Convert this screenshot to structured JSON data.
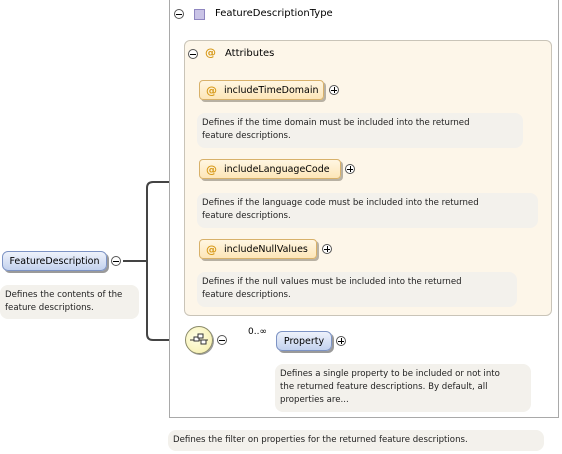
{
  "complex_type": {
    "name": "FeatureDescriptionType"
  },
  "attributes_group": {
    "label": "Attributes",
    "items": [
      {
        "name": "includeTimeDomain",
        "doc_lines": [
          "Defines if the time domain must be included into the returned",
          "feature descriptions."
        ]
      },
      {
        "name": "includeLanguageCode",
        "doc_lines": [
          "Defines if the language code must be included into the returned",
          "feature descriptions."
        ]
      },
      {
        "name": "includeNullValues",
        "doc_lines": [
          "Defines if the null values must be included into the returned",
          "feature descriptions."
        ]
      }
    ]
  },
  "root_element": {
    "name": "FeatureDescription",
    "doc_lines": [
      "Defines the contents of the",
      "feature descriptions."
    ]
  },
  "sequence": {
    "child": {
      "name": "Property",
      "occurrence": "0..∞",
      "doc_lines": [
        "Defines a single property to be included or not into",
        "the returned feature descriptions. By default, all",
        "properties are..."
      ]
    }
  },
  "bottom_doc": {
    "text": "Defines the filter on properties for the returned feature descriptions."
  },
  "icons": {
    "type": "complex-type-icon",
    "attribute": "at-icon",
    "sequence": "sequence-icon"
  },
  "colors": {
    "attribute_fill": "#fde6b8",
    "element_fill": "#c3d2ee",
    "group_bg": "#fdf6e9",
    "type_icon": "#c9c3e6"
  }
}
